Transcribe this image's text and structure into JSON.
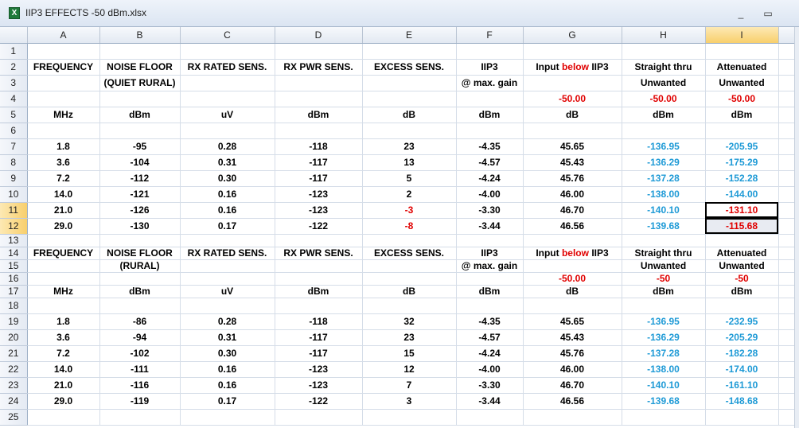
{
  "window": {
    "title": "IIP3 EFFECTS -50 dBm.xlsx",
    "app_icon": "X",
    "minimize_glyph": "_",
    "restore_glyph": "▭"
  },
  "colors": {
    "cyan": "#1e9ad6",
    "red": "#e00000",
    "header_bg": "#e3e9f2",
    "selected_header": "#f8cf6c"
  },
  "icons": {
    "app": "excel-icon"
  },
  "columns": [
    "A",
    "B",
    "C",
    "D",
    "E",
    "F",
    "G",
    "H",
    "I"
  ],
  "selected_column": "I",
  "selected_rows": [
    "11",
    "12"
  ],
  "headers_top": {
    "row2": [
      "FREQUENCY",
      "NOISE FLOOR",
      "RX RATED SENS.",
      "RX PWR SENS.",
      "EXCESS SENS.",
      "IIP3",
      "Input ",
      "below",
      " IIP3",
      "Straight thru",
      "Attenuated"
    ],
    "row3": [
      "",
      "(QUIET RURAL)",
      "",
      "",
      "",
      "@ max. gain",
      "",
      "Unwanted",
      "Unwanted"
    ],
    "row4": [
      "",
      "",
      "",
      "",
      "",
      "",
      "-50.00",
      "-50.00",
      "-50.00"
    ],
    "row5": [
      "MHz",
      "dBm",
      "uV",
      "dBm",
      "dB",
      "dBm",
      "dB",
      "dBm",
      "dBm"
    ]
  },
  "table_top": [
    [
      "1.8",
      "-95",
      "0.28",
      "-118",
      "23",
      "-4.35",
      "45.65",
      "-136.95",
      "-205.95"
    ],
    [
      "3.6",
      "-104",
      "0.31",
      "-117",
      "13",
      "-4.57",
      "45.43",
      "-136.29",
      "-175.29"
    ],
    [
      "7.2",
      "-112",
      "0.30",
      "-117",
      "5",
      "-4.24",
      "45.76",
      "-137.28",
      "-152.28"
    ],
    [
      "14.0",
      "-121",
      "0.16",
      "-123",
      "2",
      "-4.00",
      "46.00",
      "-138.00",
      "-144.00"
    ],
    [
      "21.0",
      "-126",
      "0.16",
      "-123",
      "-3",
      "-3.30",
      "46.70",
      "-140.10",
      "-131.10"
    ],
    [
      "29.0",
      "-130",
      "0.17",
      "-122",
      "-8",
      "-3.44",
      "46.56",
      "-139.68",
      "-115.68"
    ]
  ],
  "headers_bottom": {
    "row14": [
      "FREQUENCY",
      "NOISE FLOOR",
      "RX RATED SENS.",
      "RX PWR SENS.",
      "EXCESS SENS.",
      "IIP3",
      "Input ",
      "below",
      " IIP3",
      "Straight thru",
      "Attenuated"
    ],
    "row15": [
      "",
      "(RURAL)",
      "",
      "",
      "",
      "@ max. gain",
      "",
      "Unwanted",
      "Unwanted"
    ],
    "row16": [
      "",
      "",
      "",
      "",
      "",
      "",
      "-50.00",
      "-50",
      "-50"
    ],
    "row17": [
      "MHz",
      "dBm",
      "uV",
      "dBm",
      "dB",
      "dBm",
      "dB",
      "dBm",
      "dBm"
    ]
  },
  "table_bottom": [
    [
      "1.8",
      "-86",
      "0.28",
      "-118",
      "32",
      "-4.35",
      "45.65",
      "-136.95",
      "-232.95"
    ],
    [
      "3.6",
      "-94",
      "0.31",
      "-117",
      "23",
      "-4.57",
      "45.43",
      "-136.29",
      "-205.29"
    ],
    [
      "7.2",
      "-102",
      "0.30",
      "-117",
      "15",
      "-4.24",
      "45.76",
      "-137.28",
      "-182.28"
    ],
    [
      "14.0",
      "-111",
      "0.16",
      "-123",
      "12",
      "-4.00",
      "46.00",
      "-138.00",
      "-174.00"
    ],
    [
      "21.0",
      "-116",
      "0.16",
      "-123",
      "7",
      "-3.30",
      "46.70",
      "-140.10",
      "-161.10"
    ],
    [
      "29.0",
      "-119",
      "0.17",
      "-122",
      "3",
      "-3.44",
      "46.56",
      "-139.68",
      "-148.68"
    ]
  ],
  "row_numbers": [
    "1",
    "2",
    "3",
    "4",
    "5",
    "6",
    "7",
    "8",
    "9",
    "10",
    "11",
    "12",
    "13",
    "14",
    "15",
    "16",
    "17",
    "18",
    "19",
    "20",
    "21",
    "22",
    "23",
    "24",
    "25"
  ]
}
